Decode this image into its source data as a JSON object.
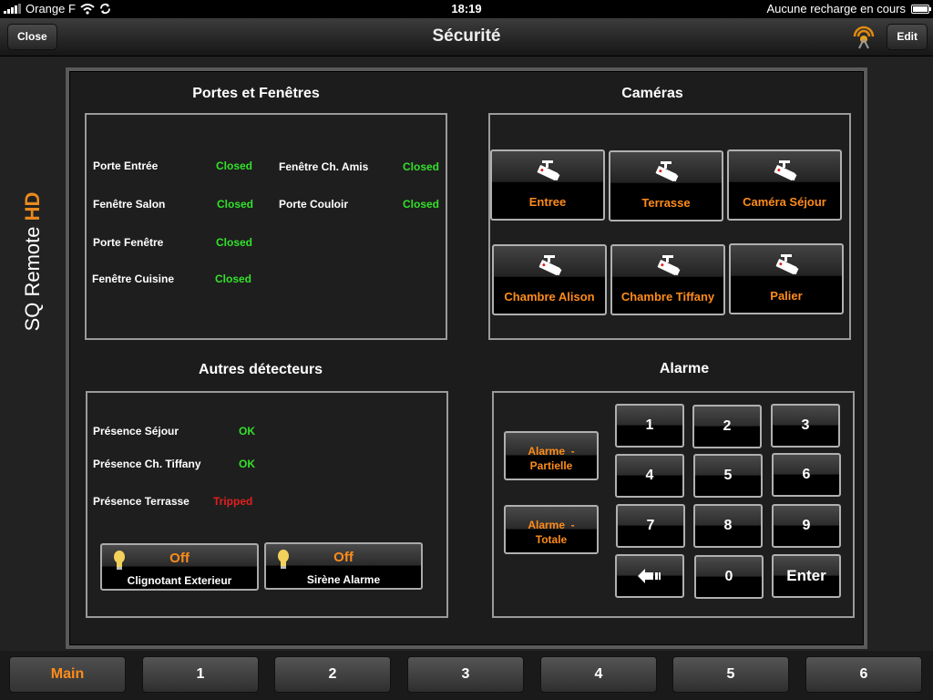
{
  "status_bar": {
    "carrier": "Orange F",
    "time": "18:19",
    "charge_status": "Aucune recharge en cours"
  },
  "nav": {
    "title": "Sécurité",
    "close_label": "Close",
    "edit_label": "Edit"
  },
  "brand": {
    "name": "SQ Remote",
    "suffix": "HD"
  },
  "doors": {
    "title": "Portes et Fenêtres",
    "items": [
      {
        "label": "Porte Entrée",
        "state": "Closed"
      },
      {
        "label": "Fenêtre Ch. Amis",
        "state": "Closed"
      },
      {
        "label": "Fenêtre Salon",
        "state": "Closed"
      },
      {
        "label": "Porte Couloir",
        "state": "Closed"
      },
      {
        "label": "Porte Fenêtre",
        "state": "Closed"
      },
      {
        "label": "Fenêtre Cuisine",
        "state": "Closed"
      }
    ]
  },
  "cameras": {
    "title": "Caméras",
    "items": [
      {
        "label": "Entree"
      },
      {
        "label": "Terrasse"
      },
      {
        "label": "Caméra Séjour"
      },
      {
        "label": "Chambre Alison"
      },
      {
        "label": "Chambre Tiffany"
      },
      {
        "label": "Palier"
      }
    ]
  },
  "detectors": {
    "title": "Autres détecteurs",
    "items": [
      {
        "label": "Présence Séjour",
        "state": "OK"
      },
      {
        "label": "Présence Ch. Tiffany",
        "state": "OK"
      },
      {
        "label": "Présence Terrasse",
        "state": "Tripped"
      }
    ],
    "toggles": [
      {
        "state": "Off",
        "name": "Clignotant Exterieur"
      },
      {
        "state": "Off",
        "name": "Sirène Alarme"
      }
    ]
  },
  "alarm": {
    "title": "Alarme",
    "partial_line1": "Alarme  -",
    "partial_line2": "Partielle",
    "total_line1": "Alarme  -",
    "total_line2": "Totale",
    "keys": [
      "1",
      "2",
      "3",
      "4",
      "5",
      "6",
      "7",
      "8",
      "9",
      "0",
      "Enter"
    ]
  },
  "tabs": [
    "Main",
    "1",
    "2",
    "3",
    "4",
    "5",
    "6"
  ],
  "colors": {
    "accent": "#ff8c1a",
    "ok": "#33e02a",
    "alert": "#e02020"
  }
}
